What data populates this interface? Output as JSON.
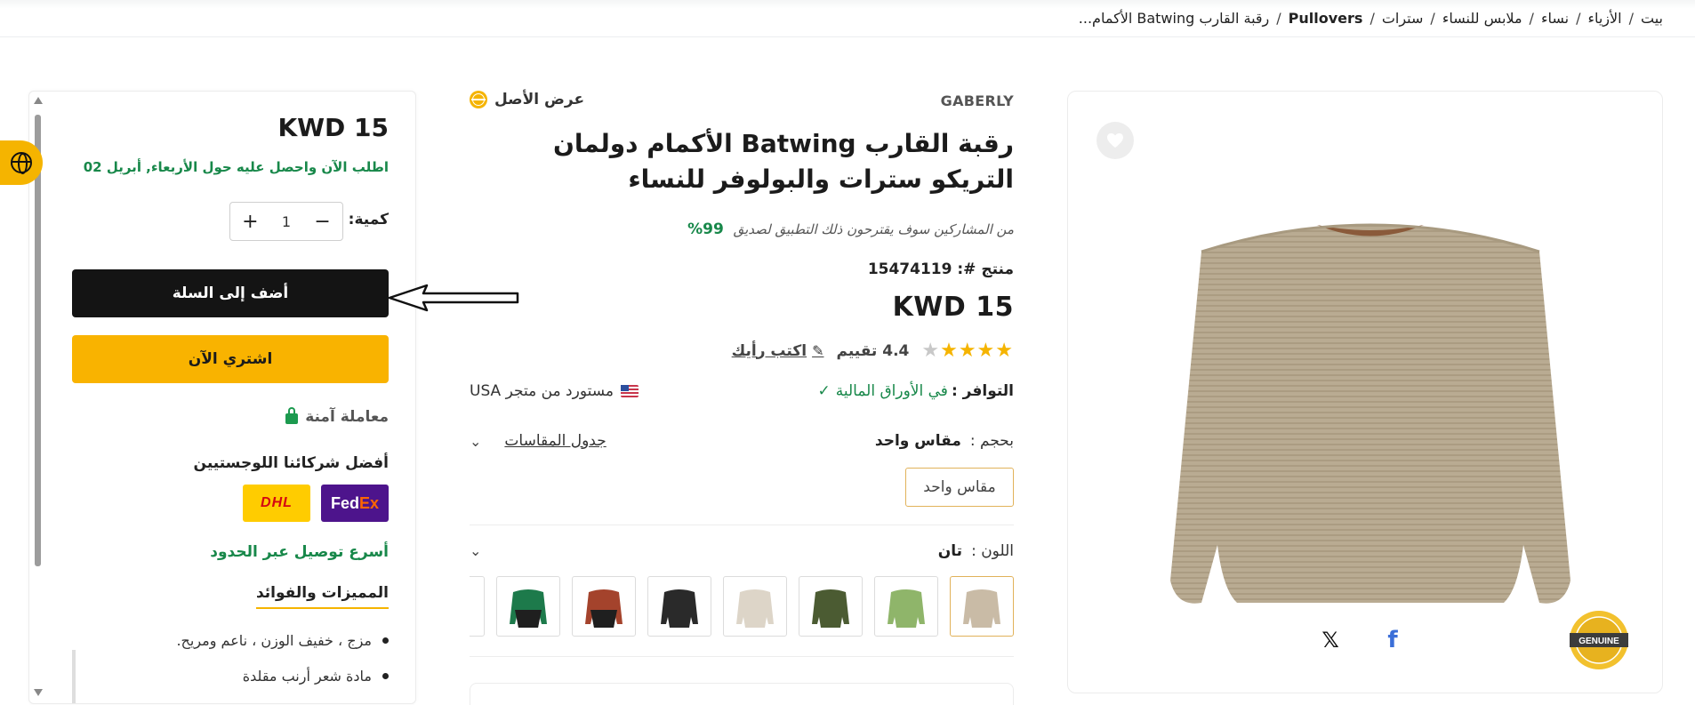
{
  "breadcrumb": {
    "items": [
      "بيت",
      "الأزياء",
      "نساء",
      "ملابس للنساء",
      "سترات",
      "Pullovers",
      "رقبة القارب Batwing الأكمام..."
    ],
    "separator": "/"
  },
  "product": {
    "brand": "GABERLY",
    "view_original": "عرض الأصل",
    "title": "رقبة القارب Batwing الأكمام دولمان التريكو سترات والبولوفر للنساء",
    "recommend_text": "من المشاركين سوف يقترحون ذلك التطبيق لصديق",
    "recommend_pct": "99%",
    "product_no_label": "منتج #:",
    "product_no": "15474119",
    "price": "KWD 15",
    "stars": "★★★★",
    "half_star": "★",
    "rating": "4.4",
    "reviews_label": "تقييم",
    "write_review": "اكتب رأيك",
    "availability_label": "التوافر :",
    "availability_value": "في الأوراق المالية",
    "imported_from": "مستورد من متجر USA",
    "size_label": "بحجم :",
    "size_value": "مقاس واحد",
    "size_chart": "جدول المقاسات",
    "size_option": "مقاس واحد",
    "color_label": "اللون :",
    "color_value": "تان",
    "swatches": [
      {
        "name": "tan",
        "color": "#c9bba6"
      },
      {
        "name": "light-green",
        "color": "#8fb56a"
      },
      {
        "name": "olive",
        "color": "#4b5b32"
      },
      {
        "name": "beige",
        "color": "#ddd5c8"
      },
      {
        "name": "black",
        "color": "#2a2a2a"
      },
      {
        "name": "rust-black",
        "color": "#a4432c"
      },
      {
        "name": "green-black",
        "color": "#1d7a4b"
      }
    ]
  },
  "purchase": {
    "price": "KWD 15",
    "delivery": "اطلب الآن واحصل عليه حول الأربعاء, أبريل 02",
    "qty_label": "كمية:",
    "qty_value": "1",
    "qty_minus": "−",
    "qty_plus": "+",
    "add_to_cart": "أضف إلى السلة",
    "buy_now": "اشتري الآن",
    "secure": "معاملة آمنة",
    "logistics_title": "أفضل شركائنا اللوجستيين",
    "fedex_a": "Fed",
    "fedex_b": "Ex",
    "dhl": "DHL",
    "fastest": "أسرع توصيل عبر الحدود",
    "features_title": "المميزات والفوائد",
    "features": [
      "مزج ، خفيف الوزن ، ناعم ومريح.",
      "مادة شعر أرنب مقلدة"
    ]
  },
  "share": {
    "x": "𝕏",
    "facebook": "f"
  },
  "badge": {
    "genuine": "GENUINE"
  },
  "colors": {
    "accent": "#f5b400",
    "green": "#18884a",
    "dark": "#141414"
  }
}
